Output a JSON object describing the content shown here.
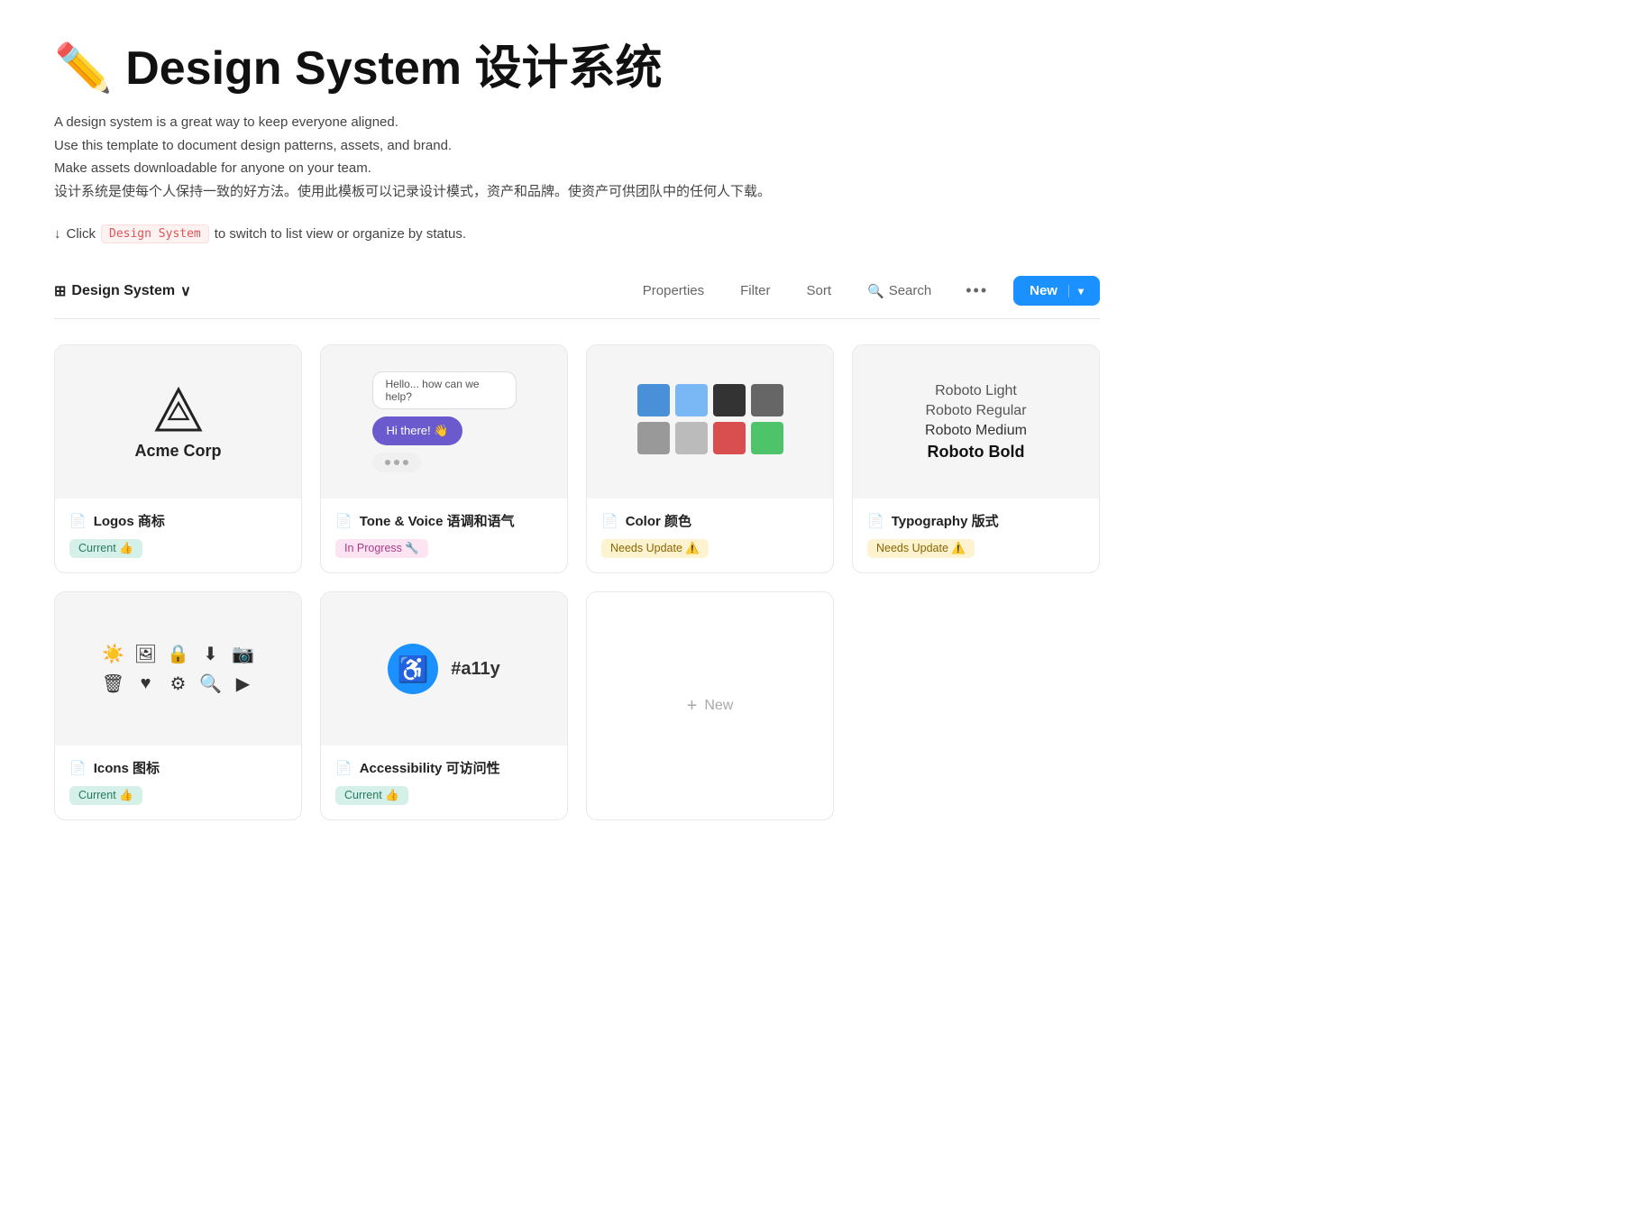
{
  "page": {
    "title": "✏️ Design System 设计系统",
    "description_lines": [
      "A design system is a great way to keep everyone aligned.",
      "Use this template to document design patterns, assets, and brand.",
      "Make assets downloadable for anyone on your team.",
      "设计系统是使每个人保持一致的好方法。使用此模板可以记录设计模式，资产和品牌。使资产可供团队中的任何人下载。"
    ],
    "hint_arrow": "↓",
    "hint_text_before": "Click",
    "hint_chip": "Design System",
    "hint_text_after": "to switch to list view or organize by status."
  },
  "toolbar": {
    "view_icon": "⊞",
    "title": "Design System",
    "chevron": "∨",
    "properties_label": "Properties",
    "filter_label": "Filter",
    "sort_label": "Sort",
    "search_icon": "⌕",
    "search_label": "Search",
    "dots_label": "•••",
    "new_label": "New",
    "new_caret": "▾"
  },
  "cards": [
    {
      "id": "logos",
      "title": "Logos 商标",
      "badge_text": "Current 👍",
      "badge_type": "current",
      "thumb_type": "logos"
    },
    {
      "id": "tone",
      "title": "Tone & Voice 语调和语气",
      "badge_text": "In Progress 🔧",
      "badge_type": "inprogress",
      "thumb_type": "tone"
    },
    {
      "id": "color",
      "title": "Color 颜色",
      "badge_text": "Needs Update ⚠️",
      "badge_type": "needs-update",
      "thumb_type": "color"
    },
    {
      "id": "typography",
      "title": "Typography 版式",
      "badge_text": "Needs Update ⚠️",
      "badge_type": "needs-update",
      "thumb_type": "typography"
    },
    {
      "id": "icons",
      "title": "Icons 图标",
      "badge_text": "Current 👍",
      "badge_type": "current",
      "thumb_type": "icons"
    },
    {
      "id": "accessibility",
      "title": "Accessibility 可访问性",
      "badge_text": "Current 👍",
      "badge_type": "current",
      "thumb_type": "accessibility"
    }
  ],
  "new_card": {
    "plus": "+",
    "label": "New"
  },
  "color_swatches": [
    {
      "color": "#4A8FE0"
    },
    {
      "color": "#6CB8F0"
    },
    {
      "color": "#333333"
    },
    {
      "color": "#666666"
    },
    {
      "color": "#999999"
    },
    {
      "color": "#BBBBBB"
    },
    {
      "color": "#D94F4F"
    },
    {
      "color": "#4DC46A"
    },
    {
      "color": "#F5C842"
    },
    {
      "color": "#f5f5f5"
    }
  ],
  "typography_weights": [
    {
      "label": "Roboto Light",
      "weight": "300"
    },
    {
      "label": "Roboto Regular",
      "weight": "400"
    },
    {
      "label": "Roboto Medium",
      "weight": "500"
    },
    {
      "label": "Roboto Bold",
      "weight": "700"
    }
  ]
}
